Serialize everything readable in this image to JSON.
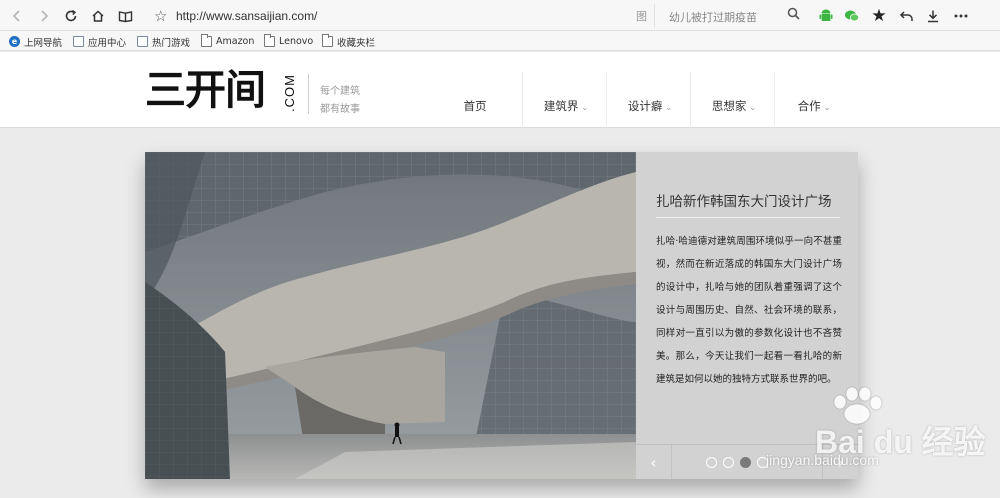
{
  "browser": {
    "url": "http://www.sansaijian.com/",
    "reader_label": "图",
    "search_placeholder": "幼儿被打过期疫苗",
    "icons": {
      "back": "back-arrow-icon",
      "forward": "forward-arrow-icon",
      "reload": "reload-icon",
      "home": "home-icon",
      "reader": "reader-icon",
      "bookmark": "star-outline-icon",
      "search": "search-icon",
      "android": "android-icon",
      "wechat": "wechat-icon",
      "favorites": "star-filled-icon",
      "undo": "undo-icon",
      "download": "download-icon",
      "menu": "more-icon"
    },
    "colors": {
      "android": "#3cb543",
      "wechat": "#3cb543"
    }
  },
  "bookmarks": [
    {
      "label": "上网导航",
      "icon": "ie-icon"
    },
    {
      "label": "应用中心",
      "icon": "page-icon"
    },
    {
      "label": "热门游戏",
      "icon": "page-icon"
    },
    {
      "label": "Amazon",
      "icon": "folder-icon"
    },
    {
      "label": "Lenovo",
      "icon": "folder-icon"
    },
    {
      "label": "收藏夹栏",
      "icon": "folder-icon"
    }
  ],
  "site": {
    "logo_text": "三开间",
    "logo_suffix": ".COM",
    "tagline_1": "每个建筑",
    "tagline_2": "都有故事",
    "nav": [
      {
        "label": "首页",
        "has_menu": false
      },
      {
        "label": "建筑界",
        "has_menu": true
      },
      {
        "label": "设计癖",
        "has_menu": true
      },
      {
        "label": "思想家",
        "has_menu": true
      },
      {
        "label": "合作",
        "has_menu": true
      }
    ]
  },
  "slide": {
    "title": "扎哈新作韩国东大门设计广场",
    "body": "扎哈·哈迪德对建筑周围环境似乎一向不甚重视，然而在新近落成的韩国东大门设计广场的设计中，扎哈与她的团队着重强调了这个设计与周围历史、自然、社会环境的联系，同样对一直引以为傲的参数化设计也不吝赞美。那么，今天让我们一起看一看扎哈的新建筑是如何以她的独特方式联系世界的吧。",
    "dots_total": 4,
    "active_dot": 3,
    "prev_label": "‹",
    "next_label": "›"
  },
  "watermark": {
    "brand": "Bai du 经验",
    "url": "jingyan.baidu.com"
  }
}
